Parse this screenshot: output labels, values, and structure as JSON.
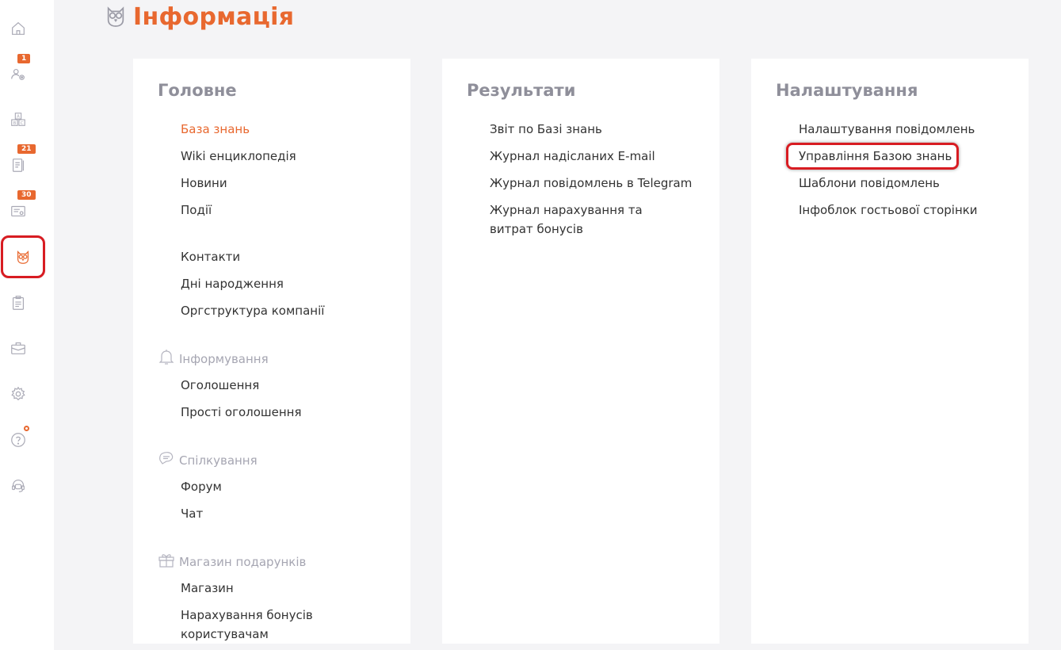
{
  "sidebar": {
    "items": [
      {
        "icon": "home-icon",
        "badge": null
      },
      {
        "icon": "users-gear-icon",
        "badge": "1"
      },
      {
        "icon": "abc-blocks-icon",
        "badge": null
      },
      {
        "icon": "notebook-icon",
        "badge": "21"
      },
      {
        "icon": "certificate-icon",
        "badge": "30"
      },
      {
        "icon": "owl-icon",
        "badge": null,
        "active": true
      },
      {
        "icon": "clipboard-icon",
        "badge": null
      },
      {
        "icon": "briefcase-icon",
        "badge": null
      },
      {
        "icon": "gear-icon",
        "badge": null
      },
      {
        "icon": "help-icon",
        "badge": null,
        "dot": true
      },
      {
        "icon": "support-headset-icon",
        "badge": null
      }
    ]
  },
  "page": {
    "title": "Інформація",
    "icon": "owl-icon"
  },
  "columns": [
    {
      "title": "Головне",
      "links": [
        "База знань",
        "Wiki енциклопедія",
        "Новини",
        "Події",
        "Контакти",
        "Дні народження",
        "Оргструктура компанії"
      ],
      "sections": [
        {
          "label": "Інформування",
          "icon": "bell-icon",
          "links": [
            "Оголошення",
            "Прості оголошення"
          ]
        },
        {
          "label": "Спілкування",
          "icon": "chat-icon",
          "links": [
            "Форум",
            "Чат"
          ]
        },
        {
          "label": "Магазин подарунків",
          "icon": "gift-icon",
          "links": [
            "Магазин",
            "Нарахування бонусів користувачам"
          ]
        }
      ]
    },
    {
      "title": "Результати",
      "links": [
        "Звіт по Базі знань",
        "Журнал надісланих E-mail",
        "Журнал повідомлень в Telegram",
        "Журнал нарахування та витрат бонусів"
      ]
    },
    {
      "title": "Налаштування",
      "links": [
        "Налаштування повідомлень",
        "Управління Базою знань",
        "Шаблони повідомлень",
        "Інфоблок гостьової сторінки"
      ]
    }
  ],
  "colors": {
    "accent": "#e8682f",
    "highlight": "#d81c22",
    "muted": "#8f8f9a"
  }
}
